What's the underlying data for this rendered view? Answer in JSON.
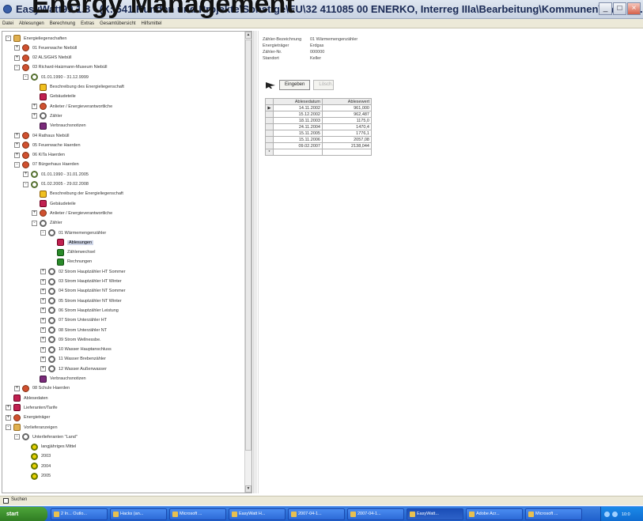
{
  "window": {
    "title": "EasyWatt99 1.8 - (X:\\541\\Kunden und Projekte\\Sonstige\\EU\\32 411085 00 ENERKO, Interreg IIIa\\Bearbeitung\\Kommunen\\Easy W...",
    "overlay_heading": "Energy Management",
    "buttons": {
      "minimize": "_",
      "maximize": "□",
      "close": "×"
    }
  },
  "menu": [
    "Datei",
    "Ablesungen",
    "Berechnung",
    "Extras",
    "Gesamtübersicht",
    "Hilfsmittel"
  ],
  "tree": [
    {
      "depth": 0,
      "toggle": "-",
      "icon": "folder",
      "label": "Energieliegenschaften"
    },
    {
      "depth": 1,
      "toggle": "+",
      "icon": "person",
      "label": "01 Feuerwache Niebüll"
    },
    {
      "depth": 1,
      "toggle": "+",
      "icon": "person",
      "label": "02 ALS/GHS Niebüll"
    },
    {
      "depth": 1,
      "toggle": "-",
      "icon": "person",
      "label": "03 Richard-Haizmann-Museum Niebüll"
    },
    {
      "depth": 2,
      "toggle": "-",
      "icon": "clock",
      "label": "01.01.1990 - 31.12.9999"
    },
    {
      "depth": 3,
      "toggle": "",
      "icon": "doc",
      "label": "Beschreibung des Energieliegenschaft"
    },
    {
      "depth": 3,
      "toggle": "",
      "icon": "red",
      "label": "Gebäudeteile"
    },
    {
      "depth": 3,
      "toggle": "+",
      "icon": "person",
      "label": "Anlieter / Energieverantwortliche"
    },
    {
      "depth": 3,
      "toggle": "+",
      "icon": "gear",
      "label": "Zähler"
    },
    {
      "depth": 3,
      "toggle": "",
      "icon": "purple",
      "label": "Verbrauchsnotizen"
    },
    {
      "depth": 1,
      "toggle": "+",
      "icon": "person",
      "label": "04 Rathaus Niebüll"
    },
    {
      "depth": 1,
      "toggle": "+",
      "icon": "person",
      "label": "05 Feuerwache Haerden"
    },
    {
      "depth": 1,
      "toggle": "+",
      "icon": "person",
      "label": "06 KiTa Haerden"
    },
    {
      "depth": 1,
      "toggle": "-",
      "icon": "person",
      "label": "07 Bürgerhaus Haerden"
    },
    {
      "depth": 2,
      "toggle": "+",
      "icon": "clock",
      "label": "01.01.1990 - 31.01.2005"
    },
    {
      "depth": 2,
      "toggle": "-",
      "icon": "clock",
      "label": "01.02.2005 - 29.02.2008"
    },
    {
      "depth": 3,
      "toggle": "",
      "icon": "doc",
      "label": "Beschreibung der Energieliegenschaft"
    },
    {
      "depth": 3,
      "toggle": "",
      "icon": "red",
      "label": "Gebäudeteile"
    },
    {
      "depth": 3,
      "toggle": "+",
      "icon": "person",
      "label": "Anlieter / Energieverantwortliche"
    },
    {
      "depth": 3,
      "toggle": "-",
      "icon": "gear",
      "label": "Zähler"
    },
    {
      "depth": 4,
      "toggle": "-",
      "icon": "gear",
      "label": "01 Wärmemengenzähler"
    },
    {
      "depth": 5,
      "toggle": "",
      "icon": "red",
      "label": "Ablesungen",
      "selected": true
    },
    {
      "depth": 5,
      "toggle": "",
      "icon": "green",
      "label": "Zählerwechsel"
    },
    {
      "depth": 5,
      "toggle": "",
      "icon": "green",
      "label": "Rechnungen"
    },
    {
      "depth": 4,
      "toggle": "+",
      "icon": "gear",
      "label": "02 Strom Hauptzähler HT Sommer"
    },
    {
      "depth": 4,
      "toggle": "+",
      "icon": "gear",
      "label": "03 Strom Hauptzähler HT Winter"
    },
    {
      "depth": 4,
      "toggle": "+",
      "icon": "gear",
      "label": "04 Strom Hauptzähler NT Sommer"
    },
    {
      "depth": 4,
      "toggle": "+",
      "icon": "gear",
      "label": "05 Strom Hauptzähler NT Winter"
    },
    {
      "depth": 4,
      "toggle": "+",
      "icon": "gear",
      "label": "06 Strom Hauptzähler Leistung"
    },
    {
      "depth": 4,
      "toggle": "+",
      "icon": "gear",
      "label": "07 Strom Unterzähler HT"
    },
    {
      "depth": 4,
      "toggle": "+",
      "icon": "gear",
      "label": "08 Strom Unterzähler NT"
    },
    {
      "depth": 4,
      "toggle": "+",
      "icon": "gear",
      "label": "09 Strom Wellnessbe."
    },
    {
      "depth": 4,
      "toggle": "+",
      "icon": "gear",
      "label": "10 Wasser Hauptanschluss"
    },
    {
      "depth": 4,
      "toggle": "+",
      "icon": "gear",
      "label": "11 Wasser Brebenzähler"
    },
    {
      "depth": 4,
      "toggle": "+",
      "icon": "gear",
      "label": "12 Wasser Außenwasser"
    },
    {
      "depth": 3,
      "toggle": "",
      "icon": "purple",
      "label": "Verbrauchsnotizen"
    },
    {
      "depth": 1,
      "toggle": "+",
      "icon": "person",
      "label": "08 Schule Haerden"
    },
    {
      "depth": 0,
      "toggle": "",
      "icon": "red",
      "label": "Ablesedaten"
    },
    {
      "depth": 0,
      "toggle": "+",
      "icon": "red",
      "label": "Lieferanten/Tarife"
    },
    {
      "depth": 0,
      "toggle": "+",
      "icon": "person",
      "label": "Energieträger"
    },
    {
      "depth": 0,
      "toggle": "-",
      "icon": "folder",
      "label": "Vorlieferanzeigen"
    },
    {
      "depth": 1,
      "toggle": "-",
      "icon": "gear",
      "label": "Unterlieferanten \"Land\""
    },
    {
      "depth": 2,
      "toggle": "",
      "icon": "yellow",
      "label": "langjähriges Mittel"
    },
    {
      "depth": 2,
      "toggle": "",
      "icon": "yellow",
      "label": "2003"
    },
    {
      "depth": 2,
      "toggle": "",
      "icon": "yellow",
      "label": "2004"
    },
    {
      "depth": 2,
      "toggle": "",
      "icon": "yellow",
      "label": "2005"
    }
  ],
  "meter_info": [
    {
      "key": "Zähler-Bezeichnung",
      "value": "01 Wärmemengenzähler"
    },
    {
      "key": "Energieträger",
      "value": "Erdgas"
    },
    {
      "key": "Zähler-Nr.",
      "value": "000000"
    },
    {
      "key": "Standort",
      "value": "Keller"
    }
  ],
  "actions": {
    "edit_label": "Eingeben",
    "delete_label": "Lösch."
  },
  "table": {
    "headers": [
      "Ablesedatum",
      "Ablesewert"
    ],
    "rows": [
      {
        "marker": "▶",
        "date": "14.11.2002",
        "value": "961,000"
      },
      {
        "marker": "",
        "date": "15.12.2002",
        "value": "962,487"
      },
      {
        "marker": "",
        "date": "18.11.2003",
        "value": "1175,0"
      },
      {
        "marker": "",
        "date": "24.11.2004",
        "value": "1470,4"
      },
      {
        "marker": "",
        "date": "15.11.2005",
        "value": "1776,1"
      },
      {
        "marker": "",
        "date": "15.11.2006",
        "value": "2057,08"
      },
      {
        "marker": "",
        "date": "09.02.2007",
        "value": "2138,044"
      },
      {
        "marker": "*",
        "date": "",
        "value": ""
      }
    ]
  },
  "status": {
    "text": "Suchen"
  },
  "taskbar": {
    "start_label": "start",
    "tasks": [
      "2 In... Outlo...",
      "Hacks (an...",
      "Microsoft ...",
      "EasyWatt H...",
      "2007-04-1...",
      "2007-04-1...",
      "EasyWatt...",
      "Adobe Acr...",
      "Microsoft ..."
    ],
    "active_index": 6,
    "clock": "10:0"
  }
}
